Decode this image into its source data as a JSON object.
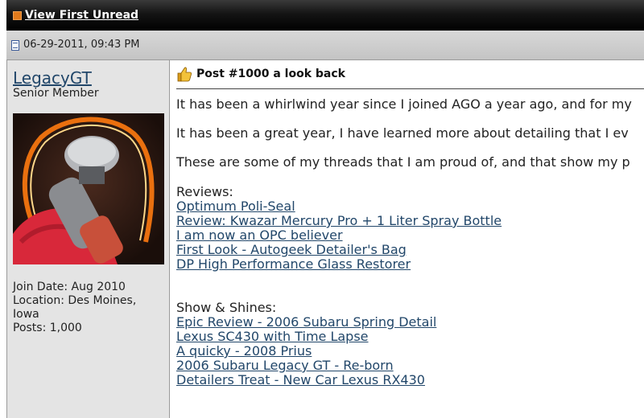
{
  "topbar": {
    "link_label": "View First Unread"
  },
  "datebar": {
    "date": "06-29-2011, 09:43 PM"
  },
  "user": {
    "name": "LegacyGT",
    "title": "Senior Member",
    "join_date": "Join Date: Aug 2010",
    "location_line1": "Location: Des Moines,",
    "location_line2": "Iowa",
    "posts": "Posts: 1,000"
  },
  "post": {
    "title": "Post #1000 a look back",
    "para1": "It has been a whirlwind year since I joined AGO a year ago, and for my",
    "para2": "It has been a great year, I have learned more about detailing that I ev",
    "para3": "These are some of my threads that I am proud of, and that show my p",
    "reviews_heading": "Reviews:",
    "reviews": [
      "Optimum Poli-Seal",
      "Review: Kwazar Mercury Pro + 1 Liter Spray Bottle",
      "I am now an OPC believer",
      "First Look - Autogeek Detailer's Bag",
      "DP High Performance Glass Restorer"
    ],
    "shines_heading": "Show & Shines:",
    "shines": [
      "Epic Review - 2006 Subaru Spring Detail",
      "Lexus SC430 with Time Lapse",
      "A quicky - 2008 Prius",
      "2006 Subaru Legacy GT - Re-born",
      "Detailers Treat - New Car Lexus RX430"
    ]
  },
  "icons": {
    "rss": "rss-icon",
    "post": "document-icon",
    "title": "thumbs-up-icon"
  },
  "colors": {
    "link": "#22476a",
    "sidebar_bg": "#e4e4e4",
    "header_bg": "#000000"
  }
}
